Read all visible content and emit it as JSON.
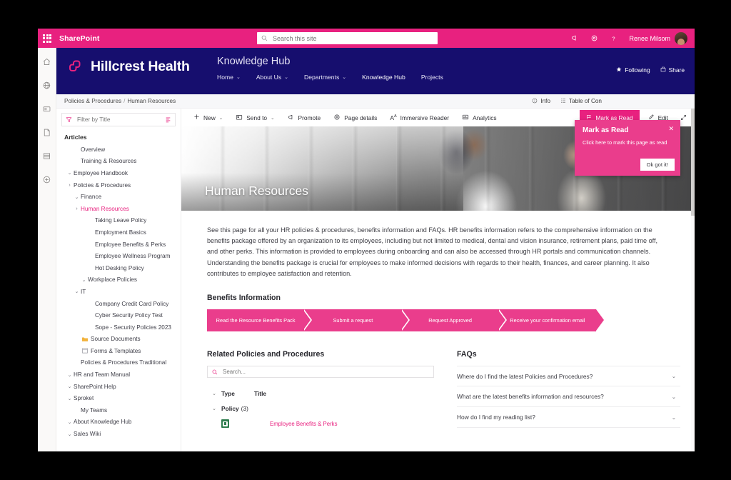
{
  "suitebar": {
    "app_name": "SharePoint",
    "search_placeholder": "Search this site",
    "user_name": "Renee Milsom",
    "icons": [
      "waffle-icon",
      "megaphone-icon",
      "settings-icon",
      "help-icon"
    ]
  },
  "rail": {
    "items": [
      {
        "name": "home-icon"
      },
      {
        "name": "globe-icon"
      },
      {
        "name": "news-icon"
      },
      {
        "name": "page-icon"
      },
      {
        "name": "list-icon"
      },
      {
        "name": "create-icon"
      }
    ]
  },
  "site_header": {
    "logo_text": "Hillcrest Health",
    "hub_title": "Knowledge Hub",
    "nav": [
      {
        "label": "Home",
        "has_chevron": true
      },
      {
        "label": "About Us",
        "has_chevron": true
      },
      {
        "label": "Departments",
        "has_chevron": true
      },
      {
        "label": "Knowledge Hub",
        "has_chevron": false
      },
      {
        "label": "Projects",
        "has_chevron": false
      }
    ],
    "following_label": "Following",
    "share_label": "Share",
    "bg_color": "#160e6e"
  },
  "breadcrumb": {
    "parent": "Policies & Procedures",
    "separator": "/",
    "current": "Human Resources",
    "right_actions": [
      {
        "label": "Info",
        "icon": "info-icon"
      },
      {
        "label": "Table of Con",
        "icon": "toc-icon"
      }
    ]
  },
  "tree": {
    "filter_placeholder": "Filter by Title",
    "heading": "Articles",
    "items": [
      {
        "label": "Overview",
        "indent": 2,
        "twisty": "",
        "selected": false
      },
      {
        "label": "Training & Resources",
        "indent": 2,
        "twisty": "",
        "selected": false
      },
      {
        "label": "Employee Handbook",
        "indent": 1,
        "twisty": "expanded",
        "selected": false
      },
      {
        "label": "Policies & Procedures",
        "indent": 1,
        "twisty": "collapsed",
        "selected": false
      },
      {
        "label": "Finance",
        "indent": 2,
        "twisty": "expanded",
        "selected": false
      },
      {
        "label": "Human Resources",
        "indent": 2,
        "twisty": "collapsed",
        "selected": true
      },
      {
        "label": "Taking Leave Policy",
        "indent": 4,
        "twisty": "",
        "selected": false
      },
      {
        "label": "Employment Basics",
        "indent": 4,
        "twisty": "",
        "selected": false
      },
      {
        "label": "Employee Benefits & Perks",
        "indent": 4,
        "twisty": "",
        "selected": false
      },
      {
        "label": "Employee Wellness Program",
        "indent": 4,
        "twisty": "",
        "selected": false
      },
      {
        "label": "Hot Desking Policy",
        "indent": 4,
        "twisty": "",
        "selected": false
      },
      {
        "label": "Workplace Policies",
        "indent": 3,
        "twisty": "expanded",
        "selected": false
      },
      {
        "label": "IT",
        "indent": 2,
        "twisty": "expanded",
        "selected": false
      },
      {
        "label": "Company Credit Card Policy",
        "indent": 4,
        "twisty": "",
        "selected": false
      },
      {
        "label": "Cyber Security Policy Test",
        "indent": 4,
        "twisty": "",
        "selected": false
      },
      {
        "label": "Sope - Security Policies 2023",
        "indent": 4,
        "twisty": "",
        "selected": false
      },
      {
        "label": "Source Documents",
        "indent": 2,
        "twisty": "",
        "icon": "folder-icon",
        "selected": false
      },
      {
        "label": "Forms & Templates",
        "indent": 2,
        "twisty": "",
        "icon": "template-icon",
        "selected": false
      },
      {
        "label": "Policies & Procedures Traditional",
        "indent": 2,
        "twisty": "",
        "selected": false
      },
      {
        "label": "HR and Team Manual",
        "indent": 1,
        "twisty": "expanded",
        "selected": false
      },
      {
        "label": "SharePoint Help",
        "indent": 1,
        "twisty": "expanded",
        "selected": false
      },
      {
        "label": "Sproket",
        "indent": 1,
        "twisty": "expanded",
        "selected": false
      },
      {
        "label": "My Teams",
        "indent": 2,
        "twisty": "",
        "selected": false
      },
      {
        "label": "About Knowledge Hub",
        "indent": 1,
        "twisty": "expanded",
        "selected": false
      },
      {
        "label": "Sales Wiki",
        "indent": 1,
        "twisty": "expanded",
        "selected": false
      }
    ]
  },
  "commandbar": {
    "items": [
      {
        "label": "New",
        "icon": "plus-icon",
        "has_chevron": true
      },
      {
        "label": "Send to",
        "icon": "sendto-icon",
        "has_chevron": true
      },
      {
        "label": "Promote",
        "icon": "promote-icon",
        "has_chevron": false
      },
      {
        "label": "Page details",
        "icon": "page-details-icon",
        "has_chevron": false
      },
      {
        "label": "Immersive Reader",
        "icon": "immersive-reader-icon",
        "has_chevron": false
      },
      {
        "label": "Analytics",
        "icon": "analytics-icon",
        "has_chevron": false
      }
    ],
    "mark_as_read": "Mark as Read",
    "edit": "Edit",
    "expand": "expand-icon",
    "accent_color": "#e8217f"
  },
  "hero": {
    "title": "Human Resources"
  },
  "body": {
    "paragraph": "See this page for all your HR policies & procedures, benefits information and FAQs. HR benefits information refers to the comprehensive information on the benefits package offered by an organization to its employees, including but not limited to medical, dental and vision insurance, retirement plans, paid time off, and other perks. This information is provided to employees during onboarding and can also be accessed through HR portals and communication channels. Understanding the benefits package is crucial for employees to make informed decisions with regards to their health, finances, and career planning. It also contributes to employee satisfaction and retention."
  },
  "benefits": {
    "title": "Benefits Information",
    "steps": [
      "Read the Resource Benefits Pack",
      "Submit a request",
      "Request Approved",
      "Receive your confirmation email"
    ],
    "color": "#ea3d8c"
  },
  "related": {
    "title": "Related Policies and Procedures",
    "search_placeholder": "Search...",
    "columns": [
      "Type",
      "Title"
    ],
    "group_label": "Policy",
    "group_count": "(3)",
    "rows": [
      {
        "title": "Employee Benefits & Perks",
        "icon": "excel-file-icon"
      }
    ]
  },
  "faqs": {
    "title": "FAQs",
    "items": [
      "Where do I find the latest Policies and Procedures?",
      "What are the latest benefits information and resources?",
      "How do I find my reading list?"
    ]
  },
  "callout": {
    "title": "Mark as Read",
    "body": "Click here to mark this page as read",
    "button": "Ok got it!",
    "close": "✕"
  }
}
